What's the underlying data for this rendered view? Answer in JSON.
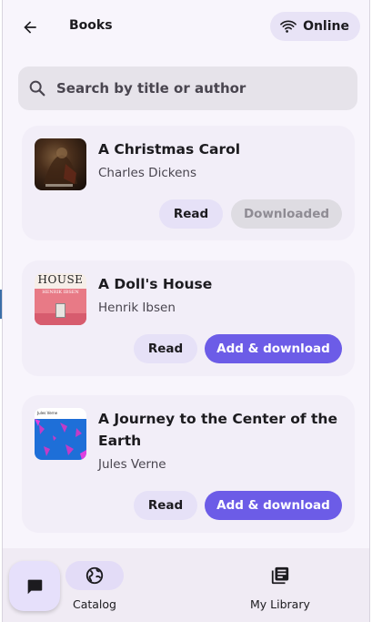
{
  "app": {
    "title": "Books",
    "status_label": "Online"
  },
  "search": {
    "placeholder": "Search by title or author"
  },
  "books": [
    {
      "title": "A Christmas Carol",
      "author": "Charles Dickens",
      "read_label": "Read",
      "action_label": "Downloaded",
      "action_state": "disabled"
    },
    {
      "title": "A Doll's House",
      "author": "Henrik Ibsen",
      "cover_text": "HOUSE",
      "cover_subtext": "HENRIK IBSEN",
      "read_label": "Read",
      "action_label": "Add & download",
      "action_state": "primary"
    },
    {
      "title": "A Journey to the Center of the Earth",
      "author": "Jules Verne",
      "cover_text": "Jules Verne",
      "read_label": "Read",
      "action_label": "Add & download",
      "action_state": "primary"
    }
  ],
  "nav": {
    "items": [
      {
        "label": "Catalog",
        "icon": "globe-icon",
        "active": true
      },
      {
        "label": "My Library",
        "icon": "library-icon",
        "active": false
      }
    ],
    "fab_icon": "chat-icon"
  },
  "colors": {
    "primary": "#6c5ce7",
    "surface": "#f8f5fc",
    "card": "#f2eef8",
    "chip": "#e8e3f6"
  }
}
